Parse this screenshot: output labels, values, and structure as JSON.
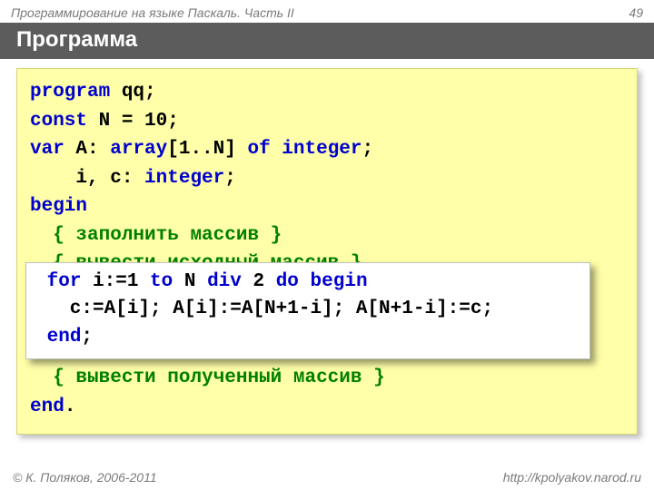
{
  "header": {
    "course": "Программирование на языке Паскаль. Часть II",
    "page": "49"
  },
  "title": "Программа",
  "code": {
    "indent": "  ",
    "l1a": "program",
    "l1b": " qq;",
    "l2a": "const",
    "l2b": " N = 10;",
    "l3a": "var",
    "l3b": " A: ",
    "l3c": "array",
    "l3d": "[1..N] ",
    "l3e": "of",
    "l3f": " ",
    "l3g": "integer",
    "l3h": ";",
    "l4a": "    i, c: ",
    "l4b": "integer",
    "l4c": ";",
    "l5": "begin",
    "l6": "{ заполнить массив }",
    "l7": "{ вывести исходный массив }",
    "l11": "{ вывести полученный массив }",
    "l12a": "end",
    "l12b": "."
  },
  "overlay": {
    "l1a": " ",
    "l1b": "for",
    "l1c": " i:=1 ",
    "l1d": "to",
    "l1e": " N ",
    "l1f": "div",
    "l1g": " 2 ",
    "l1h": "do",
    "l1i": " ",
    "l1j": "begin",
    "l2": "   c:=A[i]; A[i]:=A[N+1-i]; A[N+1-i]:=c;",
    "l3a": " ",
    "l3b": "end",
    "l3c": ";"
  },
  "footer": {
    "copyright": "© К. Поляков, 2006-2011",
    "url": "http://kpolyakov.narod.ru"
  }
}
